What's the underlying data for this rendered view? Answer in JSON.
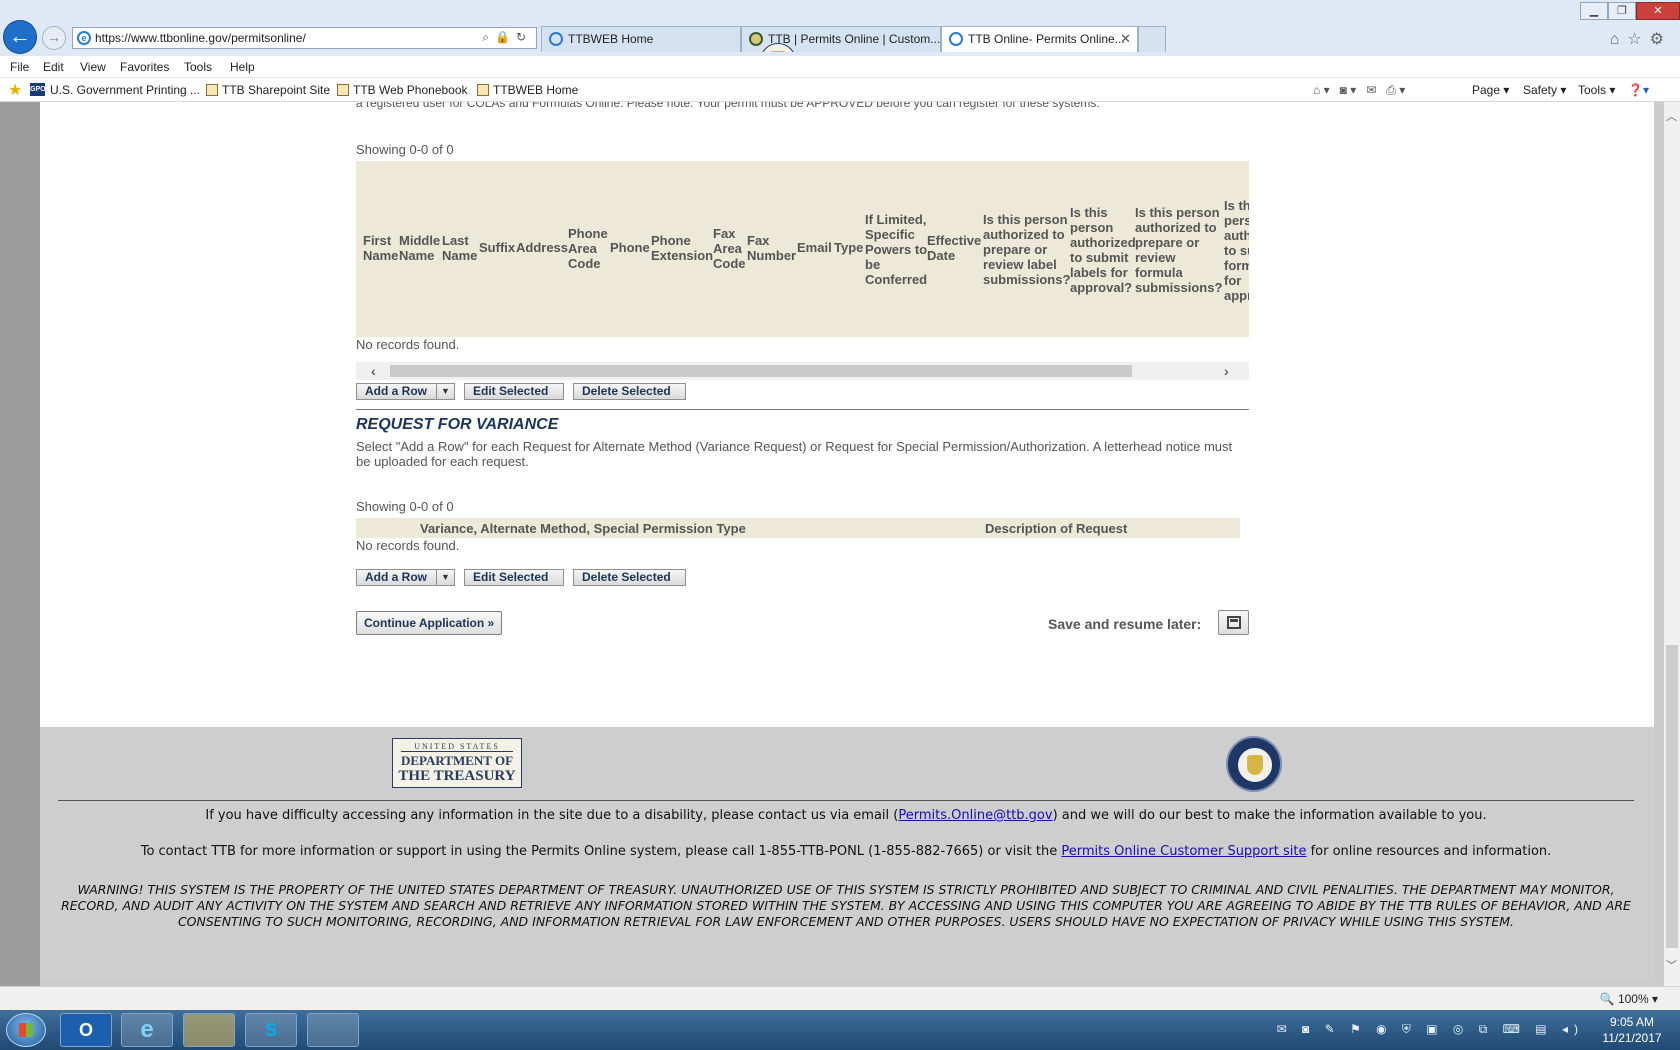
{
  "browser": {
    "url": "https://www.ttbonline.gov/permitsonline/",
    "tabs": [
      {
        "label": "TTBWEB Home",
        "icon": "ie-page-icon"
      },
      {
        "label": "TTB | Permits Online | Custom...",
        "icon": "ttb-seal-icon"
      },
      {
        "label": "TTB Online- Permits Online...",
        "icon": "ie-page-icon",
        "active": true
      }
    ],
    "menu": [
      "File",
      "Edit",
      "View",
      "Favorites",
      "Tools",
      "Help"
    ],
    "favorites": [
      "U.S. Government Printing ...",
      "TTB Sharepoint Site",
      "TTB Web Phonebook",
      "TTBWEB Home"
    ],
    "gpo_badge": "GPO",
    "commands": [
      "Page",
      "Safety",
      "Tools"
    ],
    "zoom": "100%"
  },
  "page": {
    "cut_text": "a registered user for COLAs and Formulas Online. Please note: Your permit must be APPROVED before you can register for these systems.",
    "grid1": {
      "showing": "Showing 0-0 of 0",
      "headers": [
        "First Name",
        "Middle Name",
        "Last Name",
        "Suffix",
        "Address",
        "Phone Area Code",
        "Phone",
        "Phone Extension",
        "Fax Area Code",
        "Fax Number",
        "Email",
        "Type",
        "If Limited, Specific Powers to be Conferred",
        "Effective Date",
        "Is this person authorized to prepare or review label submissions?",
        "Is this person authorized to submit labels for approval?",
        "Is this person authorized to prepare or review formula submissions?",
        "Is this person authorized to submit formulas for approval?"
      ],
      "no_records": "No records found.",
      "add_row": "Add a Row",
      "edit_selected": "Edit Selected",
      "delete_selected": "Delete Selected"
    },
    "variance": {
      "title": "REQUEST FOR VARIANCE",
      "description": "Select \"Add a Row\" for each Request for Alternate Method (Variance Request) or Request for Special Permission/Authorization. A letterhead notice must be uploaded for each request.",
      "showing": "Showing 0-0 of 0",
      "col_type": "Variance, Alternate Method, Special Permission Type",
      "col_desc": "Description of Request",
      "no_records": "No records found.",
      "add_row": "Add a Row",
      "edit_selected": "Edit Selected",
      "delete_selected": "Delete Selected"
    },
    "continue_label": "Continue Application »",
    "save_later_label": "Save and resume later:"
  },
  "footer": {
    "logo": {
      "line1": "UNITED STATES",
      "line2": "DEPARTMENT OF",
      "line3": "THE TREASURY"
    },
    "accessibility_pre": "If you have difficulty accessing any information in the site due to a disability, please contact us via email (",
    "accessibility_link": "Permits.Online@ttb.gov",
    "accessibility_post": ") and we will do our best to make the information available to you.",
    "contact_pre": "To contact TTB for more information or support in using the Permits Online system, please call 1-855-TTB-PONL (1-855-882-7665) or visit the ",
    "contact_link": "Permits Online Customer Support site",
    "contact_post": " for online resources and information.",
    "warning": "WARNING! THIS SYSTEM IS THE PROPERTY OF THE UNITED STATES DEPARTMENT OF TREASURY. UNAUTHORIZED USE OF THIS SYSTEM IS STRICTLY PROHIBITED AND SUBJECT TO CRIMINAL AND CIVIL PENALITIES. THE DEPARTMENT MAY MONITOR, RECORD, AND AUDIT ANY ACTIVITY ON THE SYSTEM AND SEARCH AND RETRIEVE ANY INFORMATION STORED WITHIN THE SYSTEM. BY ACCESSING AND USING THIS COMPUTER YOU ARE AGREEING TO ABIDE BY THE TTB RULES OF BEHAVIOR, AND ARE CONSENTING TO SUCH MONITORING, RECORDING, AND INFORMATION RETRIEVAL FOR LAW ENFORCEMENT AND OTHER PURPOSES. USERS SHOULD HAVE NO EXPECTATION OF PRIVACY WHILE USING THIS SYSTEM."
  },
  "taskbar": {
    "apps": [
      "outlook-icon",
      "internet-explorer-icon",
      "file-explorer-icon",
      "skype-icon",
      "app-window-icon"
    ],
    "app_glyphs": [
      "O",
      "e",
      "",
      "S",
      ""
    ],
    "time": "9:05 AM",
    "date": "11/21/2017"
  }
}
